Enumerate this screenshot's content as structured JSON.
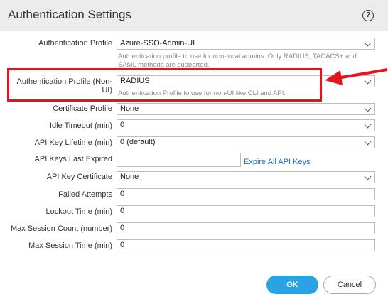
{
  "dialog": {
    "title": "Authentication Settings",
    "help_icon": "?"
  },
  "fields": {
    "auth_profile": {
      "label": "Authentication Profile",
      "value": "Azure-SSO-Admin-UI",
      "hint_line1": "Authentication profile to use for non-local admins. Only RADIUS, TACACS+ and",
      "hint_line2": "SAML methods are supported."
    },
    "auth_profile_nonui": {
      "label_line1": "Authentication Profile (Non-",
      "label_line2": "UI)",
      "value": "RADIUS",
      "hint": "Authentication Profile to use for non-UI like CLI and API."
    },
    "cert_profile": {
      "label": "Certificate Profile",
      "value": "None"
    },
    "idle_timeout": {
      "label": "Idle Timeout (min)",
      "value": "0"
    },
    "api_key_lifetime": {
      "label": "API Key Lifetime (min)",
      "value": "0 (default)"
    },
    "api_keys_last_expired": {
      "label": "API Keys Last Expired",
      "value": "",
      "link": "Expire All API Keys"
    },
    "api_key_cert": {
      "label": "API Key Certificate",
      "value": "None"
    },
    "failed_attempts": {
      "label": "Failed Attempts",
      "value": "0"
    },
    "lockout_time": {
      "label": "Lockout Time (min)",
      "value": "0"
    },
    "max_session_count": {
      "label": "Max Session Count (number)",
      "value": "0"
    },
    "max_session_time": {
      "label": "Max Session Time (min)",
      "value": "0"
    }
  },
  "buttons": {
    "ok": "OK",
    "cancel": "Cancel"
  },
  "colors": {
    "highlight": "#e3141b",
    "accent": "#29a3e3",
    "link": "#1a73c8"
  }
}
